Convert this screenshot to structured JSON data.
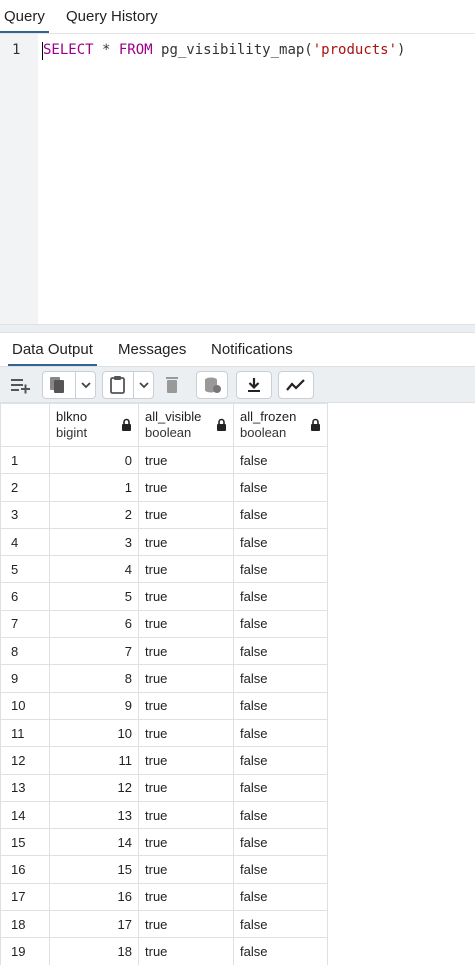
{
  "top_tabs": {
    "query": "Query",
    "history": "Query History"
  },
  "editor": {
    "line_number": "1",
    "tokens": {
      "kw1": "SELECT",
      "mid": " * ",
      "kw2": "FROM",
      "fn": " pg_visibility_map(",
      "str": "'products'",
      "end": ")"
    }
  },
  "bottom_tabs": {
    "data_output": "Data Output",
    "messages": "Messages",
    "notifications": "Notifications"
  },
  "toolbar": {
    "icons": [
      "add-row-icon",
      "copy-icon",
      "chevron-down-icon",
      "paste-icon",
      "chevron-down-icon",
      "delete-icon",
      "save-data-icon",
      "download-icon",
      "graph-icon"
    ]
  },
  "grid": {
    "columns": [
      {
        "name": "blkno",
        "type": "bigint"
      },
      {
        "name": "all_visible",
        "type": "boolean"
      },
      {
        "name": "all_frozen",
        "type": "boolean"
      }
    ],
    "rows": [
      [
        "1",
        "0",
        "true",
        "false"
      ],
      [
        "2",
        "1",
        "true",
        "false"
      ],
      [
        "3",
        "2",
        "true",
        "false"
      ],
      [
        "4",
        "3",
        "true",
        "false"
      ],
      [
        "5",
        "4",
        "true",
        "false"
      ],
      [
        "6",
        "5",
        "true",
        "false"
      ],
      [
        "7",
        "6",
        "true",
        "false"
      ],
      [
        "8",
        "7",
        "true",
        "false"
      ],
      [
        "9",
        "8",
        "true",
        "false"
      ],
      [
        "10",
        "9",
        "true",
        "false"
      ],
      [
        "11",
        "10",
        "true",
        "false"
      ],
      [
        "12",
        "11",
        "true",
        "false"
      ],
      [
        "13",
        "12",
        "true",
        "false"
      ],
      [
        "14",
        "13",
        "true",
        "false"
      ],
      [
        "15",
        "14",
        "true",
        "false"
      ],
      [
        "16",
        "15",
        "true",
        "false"
      ],
      [
        "17",
        "16",
        "true",
        "false"
      ],
      [
        "18",
        "17",
        "true",
        "false"
      ],
      [
        "19",
        "18",
        "true",
        "false"
      ]
    ]
  },
  "colors": {
    "accent": "#326690",
    "keyword": "#9a0089",
    "string": "#aa1111",
    "toolbar_bg": "#eceff2"
  }
}
